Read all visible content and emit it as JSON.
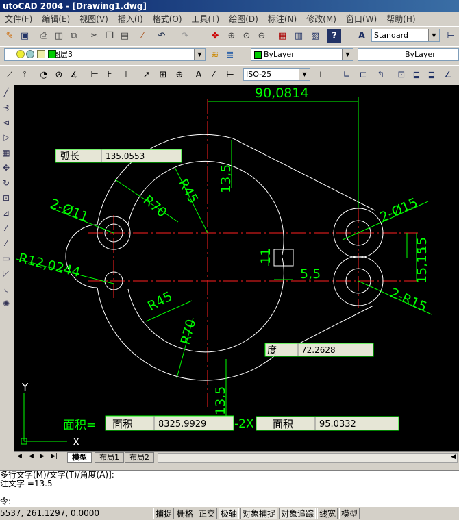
{
  "window": {
    "title": "utoCAD 2004 - [Drawing1.dwg]"
  },
  "menu": [
    "文件(F)",
    "编辑(E)",
    "视图(V)",
    "插入(I)",
    "格式(O)",
    "工具(T)",
    "绘图(D)",
    "标注(N)",
    "修改(M)",
    "窗口(W)",
    "帮助(H)"
  ],
  "toolbar": {
    "text_style": "Standard",
    "layer": "图层3",
    "color": "ByLayer",
    "linetype": "ByLayer",
    "dim_style": "ISO-25"
  },
  "drawing": {
    "dims": {
      "top_width": "90,0814",
      "vert_13_5_top": "13,5",
      "vert_13_5_bottom": "13,5",
      "r70_top": "R70",
      "r45_top": "R45",
      "r45_bottom": "R45",
      "r70_bottom": "R70",
      "holes_small": "2-Ø11",
      "holes_large": "2-Ø15",
      "r12": "R12,0244",
      "r15": "2-R15",
      "d15_15": "15,15",
      "d15": "15",
      "d11": "11",
      "d5_5": "5,5"
    },
    "axis": {
      "y": "Y",
      "x": "X"
    },
    "fields": {
      "arc_label": "弧长",
      "arc_value": "135.0553",
      "angle_label": "度",
      "angle_value": "72.2628",
      "area_prefix": "面积=",
      "area_label": "面积",
      "area_value": "8325.9929",
      "mult": "-2X",
      "area2_label": "面积",
      "area2_value": "95.0332"
    }
  },
  "tabs": [
    "模型",
    "布局1",
    "布局2"
  ],
  "command": {
    "line1": "多行文字(M)/文字(T)/角度(A)]:",
    "line2": "注文字 =13.5",
    "line3": "令:"
  },
  "status": {
    "coords": "5537, 261.1297, 0.0000",
    "buttons": [
      "捕捉",
      "栅格",
      "正交",
      "极轴",
      "对象捕捉",
      "对象追踪",
      "线宽",
      "模型"
    ]
  }
}
